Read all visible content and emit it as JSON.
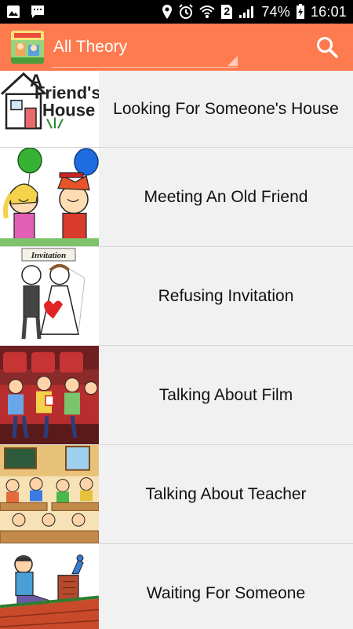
{
  "status_bar": {
    "battery_percent": "74%",
    "sim_slot": "2",
    "time": "16:01",
    "icons": [
      "image-icon",
      "message-icon",
      "location-icon",
      "alarm-icon",
      "wifi-icon",
      "sim-icon",
      "signal-icon",
      "battery-icon"
    ]
  },
  "app_bar": {
    "title": "All Theory",
    "background_color": "#fe7b4f",
    "search_icon": "search-icon"
  },
  "list": {
    "items": [
      {
        "label": "Looking For Someone's House",
        "thumb": "friends-house-thumbnail",
        "thumb_caption_line1": "A",
        "thumb_caption_line2": "Friend's",
        "thumb_caption_line3": "House"
      },
      {
        "label": "Meeting An Old Friend",
        "thumb": "friends-with-balloons-thumbnail"
      },
      {
        "label": "Refusing Invitation",
        "thumb": "wedding-invitation-thumbnail",
        "thumb_caption": "Invitation"
      },
      {
        "label": "Talking About Film",
        "thumb": "cinema-audience-thumbnail"
      },
      {
        "label": "Talking About Teacher",
        "thumb": "classroom-thumbnail"
      },
      {
        "label": "Waiting For Someone",
        "thumb": "waiting-on-roof-thumbnail"
      }
    ]
  }
}
